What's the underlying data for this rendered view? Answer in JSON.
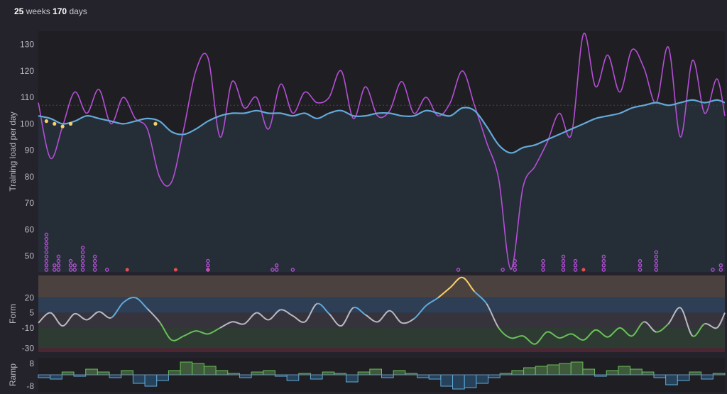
{
  "header": {
    "weeks_value": "25",
    "weeks_label": "weeks",
    "days_value": "170",
    "days_label": "days"
  },
  "colors": {
    "background": "#24232b",
    "main_plot_bg": "#1f1e22",
    "fitness": "#63a9d9",
    "training_load": "#b44fd6",
    "form_yellow": "#f7d167",
    "form_blue": "#63a9d9",
    "form_grey": "#b9b9c2",
    "form_green": "#6cbf5b",
    "marker_purple": "#b44fd6",
    "marker_red": "#e0524f",
    "ramp_fill_pos": "#3e5a3a",
    "ramp_fill_neg": "#26425a",
    "zone_transition": "#4b4240",
    "zone_fresh": "#2e3e55",
    "zone_grey": "#37333d",
    "zone_optimal": "#2e3b33",
    "zone_high_risk": "#4a2733"
  },
  "chart_data": [
    {
      "type": "line",
      "ylabel": "Training load per day",
      "yticks": [
        50,
        60,
        70,
        80,
        90,
        100,
        110,
        120,
        130
      ],
      "ylim": [
        44,
        135
      ],
      "x": [
        0,
        3,
        6,
        9,
        12,
        15,
        18,
        21,
        24,
        27,
        30,
        33,
        36,
        39,
        42,
        45,
        48,
        51,
        54,
        57,
        60,
        63,
        66,
        69,
        72,
        75,
        78,
        81,
        84,
        87,
        90,
        93,
        96,
        99,
        102,
        105,
        108,
        111,
        114,
        117,
        120,
        123,
        126,
        129,
        132,
        135,
        138,
        141,
        144,
        147,
        150,
        153,
        156,
        159,
        162,
        165,
        168,
        170
      ],
      "series": [
        {
          "key": "fitness",
          "values": [
            103,
            102,
            100,
            101,
            103,
            102,
            101,
            100,
            101,
            102,
            101,
            97,
            96,
            98,
            101,
            103,
            104,
            104,
            105,
            104,
            104,
            103,
            104,
            102,
            104,
            105,
            103,
            103,
            104,
            104,
            103,
            103,
            105,
            104,
            103,
            106,
            105,
            99,
            92,
            89,
            91,
            92,
            94,
            96,
            98,
            100,
            102,
            103,
            104,
            106,
            107,
            108,
            107,
            108,
            109,
            108,
            109,
            108
          ]
        },
        {
          "key": "training_load",
          "values": [
            108,
            87,
            99,
            112,
            104,
            113,
            100,
            110,
            102,
            98,
            80,
            78,
            98,
            120,
            125,
            95,
            116,
            106,
            110,
            98,
            115,
            104,
            112,
            108,
            110,
            120,
            102,
            114,
            103,
            105,
            116,
            104,
            110,
            103,
            108,
            120,
            107,
            93,
            79,
            45,
            76,
            84,
            93,
            104,
            96,
            134,
            114,
            126,
            112,
            128,
            121,
            108,
            129,
            95,
            124,
            104,
            117,
            103
          ]
        }
      ],
      "markers": [
        {
          "x": 2,
          "count": 9,
          "color": "purple"
        },
        {
          "x": 4,
          "count": 2,
          "color": "purple"
        },
        {
          "x": 5,
          "count": 4,
          "color": "purple"
        },
        {
          "x": 8,
          "count": 3,
          "color": "purple"
        },
        {
          "x": 9,
          "count": 2,
          "color": "purple"
        },
        {
          "x": 11,
          "count": 6,
          "color": "purple"
        },
        {
          "x": 14,
          "count": 4,
          "color": "purple"
        },
        {
          "x": 17,
          "count": 1,
          "color": "purple"
        },
        {
          "x": 22,
          "count": 1,
          "color": "red"
        },
        {
          "x": 34,
          "count": 1,
          "color": "red"
        },
        {
          "x": 42,
          "count": 1,
          "color": "red"
        },
        {
          "x": 42,
          "count": 3,
          "color": "purple"
        },
        {
          "x": 58,
          "count": 1,
          "color": "purple"
        },
        {
          "x": 59,
          "count": 2,
          "color": "purple"
        },
        {
          "x": 63,
          "count": 1,
          "color": "purple"
        },
        {
          "x": 104,
          "count": 1,
          "color": "purple"
        },
        {
          "x": 115,
          "count": 1,
          "color": "purple"
        },
        {
          "x": 118,
          "count": 3,
          "color": "purple"
        },
        {
          "x": 125,
          "count": 3,
          "color": "purple"
        },
        {
          "x": 130,
          "count": 4,
          "color": "purple"
        },
        {
          "x": 133,
          "count": 3,
          "color": "purple"
        },
        {
          "x": 135,
          "count": 1,
          "color": "red"
        },
        {
          "x": 140,
          "count": 4,
          "color": "purple"
        },
        {
          "x": 149,
          "count": 3,
          "color": "purple"
        },
        {
          "x": 153,
          "count": 5,
          "color": "purple"
        },
        {
          "x": 167,
          "count": 1,
          "color": "purple"
        },
        {
          "x": 169,
          "count": 2,
          "color": "purple"
        }
      ]
    },
    {
      "type": "line",
      "ylabel": "Form",
      "yticks": [
        20,
        5,
        -10,
        -30
      ],
      "ylim": [
        -34,
        42
      ],
      "x": [
        0,
        3,
        6,
        9,
        12,
        15,
        18,
        21,
        24,
        27,
        30,
        33,
        36,
        39,
        42,
        45,
        48,
        51,
        54,
        57,
        60,
        63,
        66,
        69,
        72,
        75,
        78,
        81,
        84,
        87,
        90,
        93,
        96,
        99,
        102,
        105,
        108,
        111,
        114,
        117,
        120,
        123,
        126,
        129,
        132,
        135,
        138,
        141,
        144,
        147,
        150,
        153,
        156,
        159,
        162,
        165,
        168,
        170
      ],
      "values": [
        -5,
        5,
        -8,
        4,
        -2,
        6,
        0,
        15,
        20,
        9,
        -4,
        -22,
        -18,
        -13,
        -16,
        -10,
        -4,
        -6,
        5,
        -2,
        8,
        2,
        -4,
        14,
        4,
        -8,
        10,
        3,
        -4,
        7,
        -5,
        -1,
        12,
        20,
        30,
        40,
        26,
        14,
        -10,
        -20,
        -18,
        -26,
        -14,
        -20,
        -16,
        -22,
        -12,
        -19,
        -10,
        -18,
        -4,
        -14,
        -6,
        10,
        -18,
        -6,
        -10,
        5
      ],
      "zones": [
        {
          "from": 20,
          "to": 42,
          "color": "transition"
        },
        {
          "from": 5,
          "to": 20,
          "color": "fresh"
        },
        {
          "from": -10,
          "to": 5,
          "color": "grey"
        },
        {
          "from": -30,
          "to": -10,
          "color": "optimal"
        },
        {
          "from": -34,
          "to": -30,
          "color": "high_risk"
        }
      ]
    },
    {
      "type": "bar",
      "ylabel": "Ramp",
      "yticks": [
        8,
        -8
      ],
      "ylim": [
        -12,
        12
      ],
      "x": [
        0,
        3,
        6,
        9,
        12,
        15,
        18,
        21,
        24,
        27,
        30,
        33,
        36,
        39,
        42,
        45,
        48,
        51,
        54,
        57,
        60,
        63,
        66,
        69,
        72,
        75,
        78,
        81,
        84,
        87,
        90,
        93,
        96,
        99,
        102,
        105,
        108,
        111,
        114,
        117,
        120,
        123,
        126,
        129,
        132,
        135,
        138,
        141,
        144,
        147,
        150,
        153,
        156,
        159,
        162,
        165,
        168,
        170
      ],
      "values": [
        -2,
        -3,
        2,
        -1,
        4,
        2,
        -2,
        3,
        -6,
        -8,
        -4,
        3,
        9,
        8,
        6,
        3,
        1,
        -2,
        2,
        3,
        -1,
        -4,
        1,
        -3,
        2,
        1,
        -5,
        2,
        4,
        -2,
        3,
        1,
        -2,
        -3,
        -8,
        -10,
        -9,
        -6,
        -2,
        1,
        3,
        5,
        6,
        7,
        8,
        9,
        4,
        -1,
        3,
        6,
        4,
        2,
        -2,
        -7,
        -4,
        2,
        -3,
        1
      ]
    }
  ]
}
